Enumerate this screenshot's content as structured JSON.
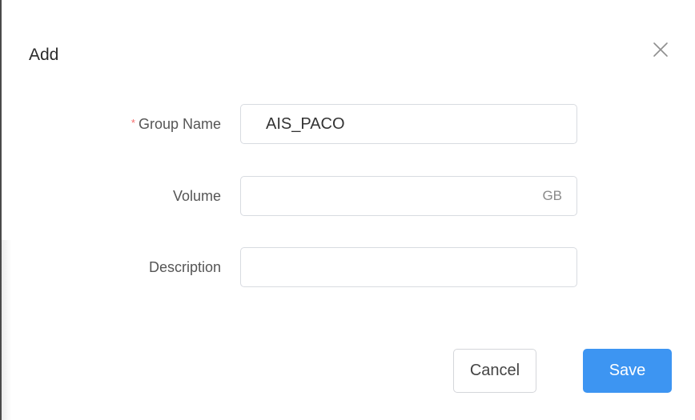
{
  "dialog": {
    "title": "Add",
    "close_icon": "close-icon"
  },
  "form": {
    "group_name": {
      "required_mark": "*",
      "label": "Group Name",
      "value": "AIS_PACO",
      "required": true
    },
    "volume": {
      "label": "Volume",
      "value": "",
      "suffix": "GB"
    },
    "description": {
      "label": "Description",
      "value": ""
    }
  },
  "actions": {
    "cancel_label": "Cancel",
    "save_label": "Save"
  },
  "colors": {
    "primary": "#3d95f2",
    "required": "#f56c6c",
    "border": "#d8dbe0"
  }
}
